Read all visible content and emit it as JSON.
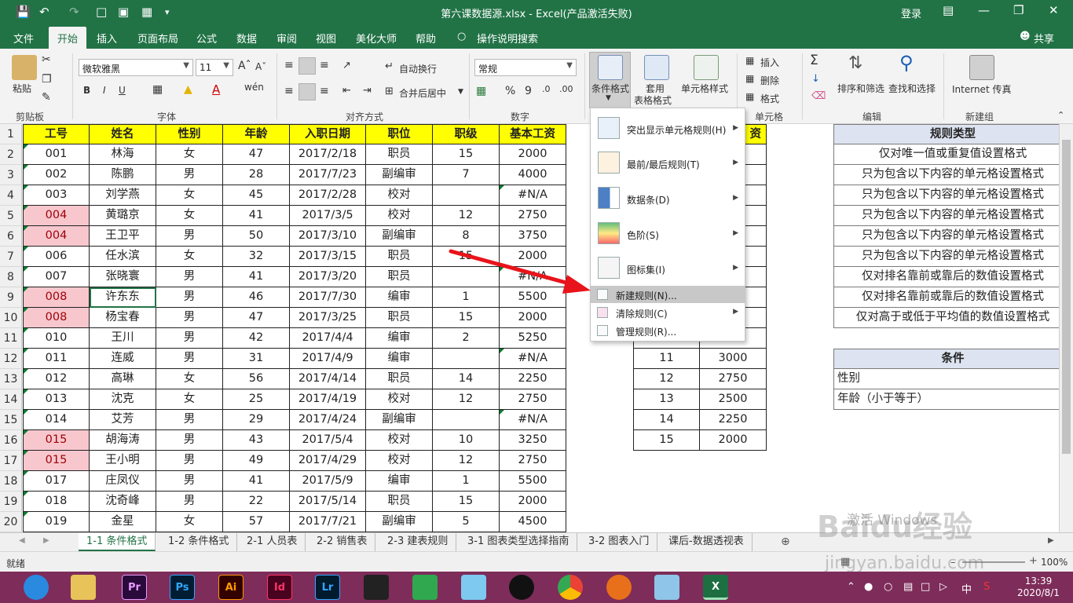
{
  "titlebar": {
    "doc_title": "第六课数据源.xlsx  -  Excel(产品激活失败)",
    "login": "登录",
    "brand_color": "#217346"
  },
  "tabs": [
    "文件",
    "开始",
    "插入",
    "页面布局",
    "公式",
    "数据",
    "审阅",
    "视图",
    "美化大师",
    "帮助"
  ],
  "active_tab": "开始",
  "tell_me": "操作说明搜索",
  "share": "共享",
  "ribbon": {
    "paste": "粘贴",
    "clipboard": "剪贴板",
    "font_name": "微软雅黑",
    "font_size": "11",
    "font_group": "字体",
    "bold": "B",
    "italic": "I",
    "underline": "U",
    "wrap_text": "自动换行",
    "merge_center": "合并后居中",
    "align_group": "对齐方式",
    "number_format": "常规",
    "number_group": "数字",
    "percent": "%",
    "comma": "9",
    "cond_format": "条件格式",
    "table_format_1": "套用",
    "table_format_2": "表格格式",
    "cell_styles": "单元格样式",
    "insert": "插入",
    "delete": "删除",
    "format": "格式",
    "cells_group": "单元格",
    "sort_filter": "排序和筛选",
    "find_select": "查找和选择",
    "editing_group": "编辑",
    "internet_fax": "Internet 传真",
    "new_group": "新建组"
  },
  "table": {
    "headers": [
      "工号",
      "姓名",
      "性别",
      "年龄",
      "入职日期",
      "职位",
      "职级",
      "基本工资"
    ],
    "rows": [
      [
        "001",
        "林海",
        "女",
        "47",
        "2017/2/18",
        "职员",
        "15",
        "2000"
      ],
      [
        "002",
        "陈鹏",
        "男",
        "28",
        "2017/7/23",
        "副编审",
        "7",
        "4000"
      ],
      [
        "003",
        "刘学燕",
        "女",
        "45",
        "2017/2/28",
        "校对",
        "",
        "#N/A"
      ],
      [
        "004",
        "黄璐京",
        "女",
        "41",
        "2017/3/5",
        "校对",
        "12",
        "2750"
      ],
      [
        "004",
        "王卫平",
        "男",
        "50",
        "2017/3/10",
        "副编审",
        "8",
        "3750"
      ],
      [
        "006",
        "任水滨",
        "女",
        "32",
        "2017/3/15",
        "职员",
        "15",
        "2000"
      ],
      [
        "007",
        "张晓寰",
        "男",
        "41",
        "2017/3/20",
        "职员",
        "",
        "#N/A"
      ],
      [
        "008",
        "许东东",
        "男",
        "46",
        "2017/7/30",
        "编审",
        "1",
        "5500"
      ],
      [
        "008",
        "杨宝春",
        "男",
        "47",
        "2017/3/25",
        "职员",
        "15",
        "2000"
      ],
      [
        "010",
        "王川",
        "男",
        "42",
        "2017/4/4",
        "编审",
        "2",
        "5250"
      ],
      [
        "011",
        "连威",
        "男",
        "31",
        "2017/4/9",
        "编审",
        "",
        "#N/A"
      ],
      [
        "012",
        "高琳",
        "女",
        "56",
        "2017/4/14",
        "职员",
        "14",
        "2250"
      ],
      [
        "013",
        "沈克",
        "女",
        "25",
        "2017/4/19",
        "校对",
        "12",
        "2750"
      ],
      [
        "014",
        "艾芳",
        "男",
        "29",
        "2017/4/24",
        "副编审",
        "",
        "#N/A"
      ],
      [
        "015",
        "胡海涛",
        "男",
        "43",
        "2017/5/4",
        "校对",
        "10",
        "3250"
      ],
      [
        "015",
        "王小明",
        "男",
        "49",
        "2017/4/29",
        "校对",
        "12",
        "2750"
      ],
      [
        "017",
        "庄凤仪",
        "男",
        "41",
        "2017/5/9",
        "编审",
        "1",
        "5500"
      ],
      [
        "018",
        "沈奇峰",
        "男",
        "22",
        "2017/5/14",
        "职员",
        "15",
        "2000"
      ],
      [
        "019",
        "金星",
        "女",
        "57",
        "2017/7/21",
        "副编审",
        "5",
        "4500"
      ]
    ],
    "pink_rows": [
      3,
      4,
      7,
      8,
      14,
      15
    ]
  },
  "row_numbers": [
    "1",
    "2",
    "3",
    "4",
    "5",
    "6",
    "7",
    "8",
    "9",
    "10",
    "11",
    "12",
    "13",
    "14",
    "15",
    "16",
    "17",
    "18",
    "19",
    "20"
  ],
  "lookup": {
    "header_tail": "资",
    "rows": [
      [
        "11",
        "3000"
      ],
      [
        "12",
        "2750"
      ],
      [
        "13",
        "2500"
      ],
      [
        "14",
        "2250"
      ],
      [
        "15",
        "2000"
      ]
    ]
  },
  "rules": {
    "title": "规则类型",
    "items": [
      "仅对唯一值或重复值设置格式",
      "只为包含以下内容的单元格设置格式",
      "只为包含以下内容的单元格设置格式",
      "只为包含以下内容的单元格设置格式",
      "只为包含以下内容的单元格设置格式",
      "只为包含以下内容的单元格设置格式",
      "仅对排名靠前或靠后的数值设置格式",
      "仅对排名靠前或靠后的数值设置格式",
      "仅对高于或低于平均值的数值设置格式"
    ],
    "cond_title": "条件",
    "conditions": [
      "性别",
      "年龄（小于等于）"
    ]
  },
  "cf_menu": {
    "items": [
      "突出显示单元格规则(H)",
      "最前/最后规则(T)",
      "数据条(D)",
      "色阶(S)",
      "图标集(I)"
    ],
    "new_rule": "新建规则(N)...",
    "clear_rule": "清除规则(C)",
    "manage_rule": "管理规则(R)..."
  },
  "sheet_tabs": [
    "1-1 条件格式",
    "1-2 条件格式",
    "2-1 人员表",
    "2-2 销售表",
    "2-3 建表规则",
    "3-1 图表类型选择指南",
    "3-2 图表入门",
    "课后-数据透视表"
  ],
  "status": "就绪",
  "zoom": "100%",
  "clock": {
    "time": "13:39",
    "date": "2020/8/1"
  },
  "taskbar_apps": [
    "Pr",
    "Ps",
    "Ai",
    "Id",
    "Lr"
  ],
  "tray_lang": "中",
  "watermark": "Baidu经验",
  "watermark_url": "jingyan.baidu.com",
  "watermark_small": "激活 Windows"
}
